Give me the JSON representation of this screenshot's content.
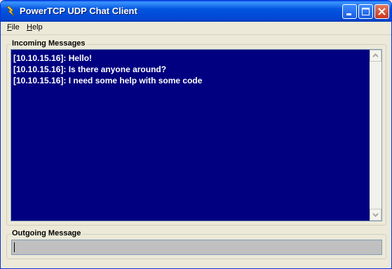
{
  "window": {
    "title": "PowerTCP UDP Chat Client",
    "icon": "lightning-app-icon"
  },
  "menu": [
    "File",
    "Help"
  ],
  "incoming": {
    "label": "Incoming Messages",
    "messages": [
      "[10.10.15.16]: Hello!",
      "[10.10.15.16]: Is there anyone around?",
      "[10.10.15.16]: I need some help with some code"
    ],
    "background_color": "#000080",
    "text_color": "#FFFFFF"
  },
  "outgoing": {
    "label": "Outgoing Message",
    "value": ""
  }
}
